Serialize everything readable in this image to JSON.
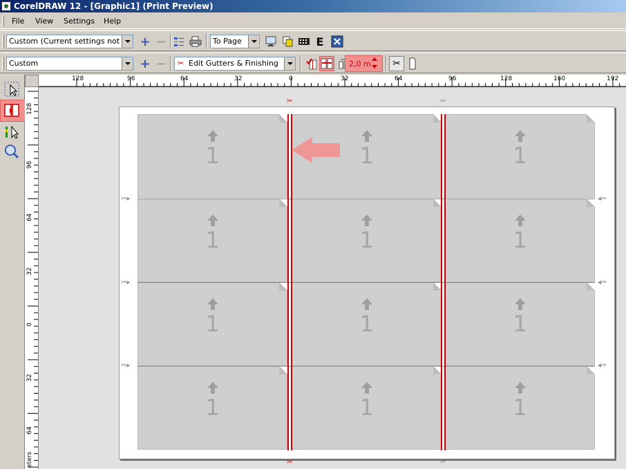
{
  "window": {
    "title": "CorelDRAW 12 - [Graphic1] (Print Preview)"
  },
  "menu": {
    "file": "File",
    "view": "View",
    "settings": "Settings",
    "help": "Help"
  },
  "toolbar1": {
    "preset_value": "Custom (Current settings not s...",
    "fit_value": "To Page",
    "add_icon": "plus-icon",
    "remove_icon": "minus-icon"
  },
  "toolbar2": {
    "layout_value": "Custom",
    "mode_value": "Edit Gutters & Finishing",
    "gutter_value": "2,0 m"
  },
  "ruler_top": [
    "128",
    "96",
    "64",
    "32",
    "0",
    "32",
    "64",
    "96",
    "128",
    "160",
    "192"
  ],
  "ruler_left": [
    "128",
    "96",
    "64",
    "32",
    "0",
    "32",
    "64"
  ],
  "ruler_unit": "eters",
  "imposition": {
    "rows": 4,
    "cols": 3,
    "card_number": "1"
  },
  "colors": {
    "gutter": "#d00000",
    "highlight": "#f28f8f",
    "card": "#cfcfcf"
  }
}
